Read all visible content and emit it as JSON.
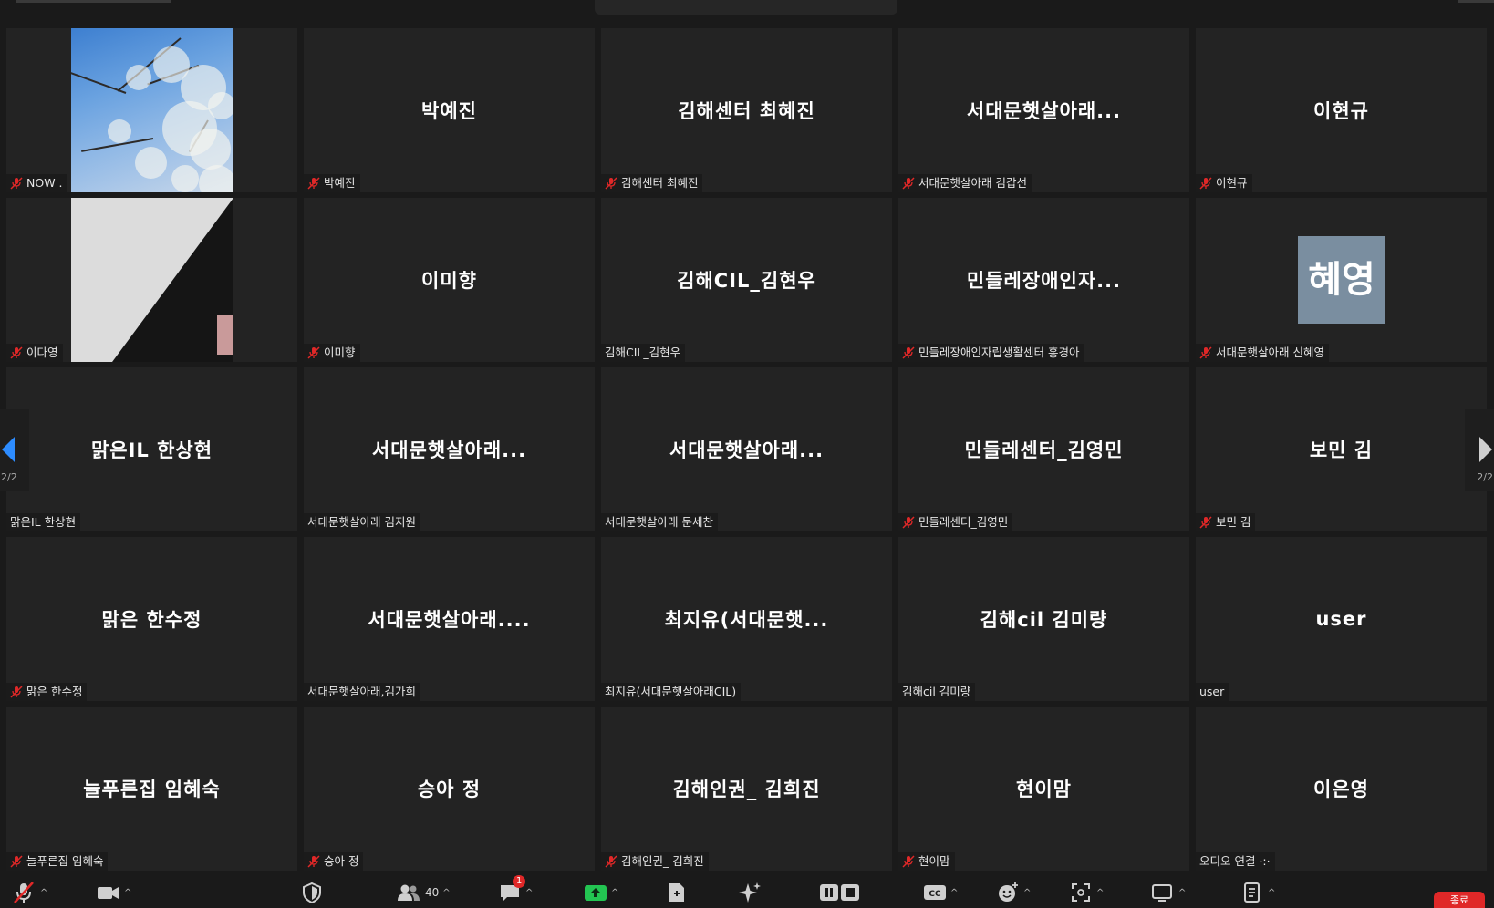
{
  "tiles": [
    {
      "label": "NOW .",
      "muted": true
    },
    {
      "name": "박예진",
      "label": "박예진",
      "muted": true
    },
    {
      "name": "김해센터 최혜진",
      "label": "김해센터 최혜진",
      "muted": true
    },
    {
      "name": "서대문햇살아래...",
      "label": "서대문햇살아래 김갑선",
      "muted": true
    },
    {
      "name": "이현규",
      "label": "이현규",
      "muted": true
    },
    {
      "label": "이다영",
      "muted": true
    },
    {
      "name": "이미향",
      "label": "이미향",
      "muted": true
    },
    {
      "name": "김해CIL_김현우",
      "label": "김해CIL_김현우",
      "muted": false
    },
    {
      "name": "민들레장애인자...",
      "label": "민들레장애인자립생활센터 홍경아",
      "muted": true
    },
    {
      "avatar": "혜영",
      "label": "서대문햇살아래 신혜영",
      "muted": true
    },
    {
      "name": "맑은IL 한상현",
      "label": "맑은IL 한상현",
      "muted": false
    },
    {
      "name": "서대문햇살아래...",
      "label": "서대문햇살아래 김지원",
      "muted": false
    },
    {
      "name": "서대문햇살아래...",
      "label": "서대문햇살아래 문세찬",
      "muted": false
    },
    {
      "name": "민들레센터_김영민",
      "label": "민들레센터_김영민",
      "muted": true
    },
    {
      "name": "보민 김",
      "label": "보민 김",
      "muted": true
    },
    {
      "name": "맑은 한수정",
      "label": "맑은 한수정",
      "muted": true
    },
    {
      "name": "서대문햇살아래....",
      "label": "서대문햇살아래,김가희",
      "muted": false
    },
    {
      "name": "최지유(서대문햇...",
      "label": "최지유(서대문햇살아래CIL)",
      "muted": false
    },
    {
      "name": "김해cil 김미량",
      "label": "김해cil 김미량",
      "muted": false
    },
    {
      "name": "user",
      "label": "user",
      "muted": false
    },
    {
      "name": "늘푸른집 임혜숙",
      "label": "늘푸른집 임혜숙",
      "muted": true
    },
    {
      "name": "승아 정",
      "label": "승아 정",
      "muted": true
    },
    {
      "name": "김해인권_ 김희진",
      "label": "김해인권_ 김희진",
      "muted": true
    },
    {
      "name": "현이맘",
      "label": "현이맘",
      "muted": true
    },
    {
      "name": "이은영",
      "label": "오디오 연결 ·:·",
      "muted": false
    }
  ],
  "pagination": {
    "left": "2/2",
    "right": "2/2"
  },
  "toolbar": {
    "participants_count": "40",
    "chat_badge": "1",
    "end_label": "종료",
    "cc_label": "CC"
  },
  "colors": {
    "accent": "#2d8cff",
    "share": "#23c552",
    "end": "#e02828",
    "muted_icon": "#e02828"
  }
}
